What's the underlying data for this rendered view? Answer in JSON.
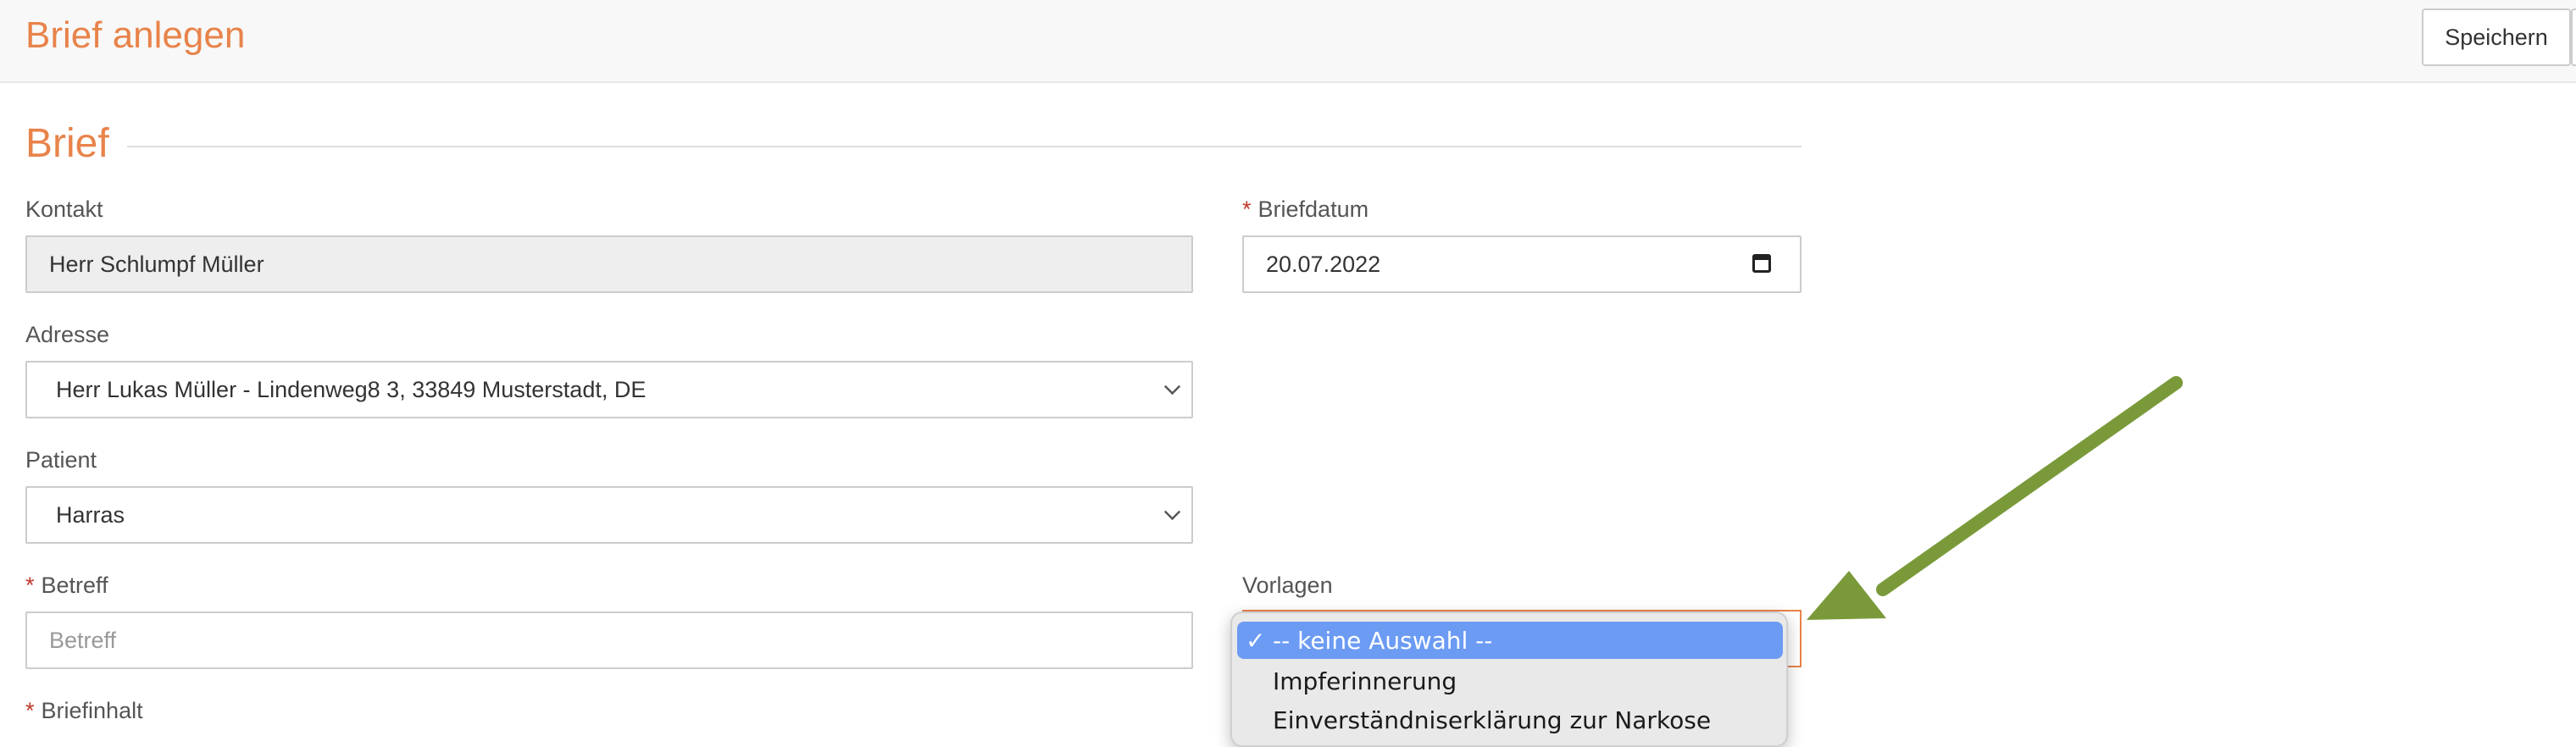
{
  "header": {
    "title": "Brief anlegen",
    "save_label": "Speichern"
  },
  "section": {
    "title": "Brief"
  },
  "form": {
    "kontakt": {
      "label": "Kontakt",
      "value": "Herr Schlumpf Müller"
    },
    "briefdatum": {
      "label": "Briefdatum",
      "required_mark": "*",
      "value": "20.07.2022"
    },
    "adresse": {
      "label": "Adresse",
      "value": "Herr Lukas Müller - Lindenweg8 3, 33849 Musterstadt, DE"
    },
    "patient": {
      "label": "Patient",
      "value": "Harras"
    },
    "betreff": {
      "label": "Betreff",
      "required_mark": "*",
      "placeholder": "Betreff"
    },
    "vorlagen": {
      "label": "Vorlagen",
      "options": [
        "-- keine Auswahl --",
        "Impferinnerung",
        "Einverständniserklärung zur Narkose"
      ],
      "selected": "-- keine Auswahl --",
      "check_mark": "✓"
    },
    "briefinhalt": {
      "label": "Briefinhalt",
      "required_mark": "*"
    }
  },
  "annotation": {
    "arrow_color": "#7a9a3a"
  },
  "colors": {
    "accent": "#e8834a",
    "selected_option": "#6b9bf3"
  }
}
